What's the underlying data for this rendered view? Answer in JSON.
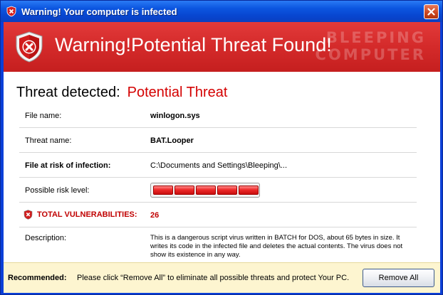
{
  "window": {
    "title": "Warning! Your computer is infected",
    "close_icon": "close-icon",
    "title_icon": "warning-shield-icon"
  },
  "banner": {
    "heading": "Warning!Potential Threat Found!",
    "watermark_line1": "BLEEPING",
    "watermark_line2": "COMPUTER",
    "icon": "shield-x-icon"
  },
  "threat": {
    "label": "Threat detected:",
    "value": "Potential Threat"
  },
  "details": {
    "file_name_label": "File name:",
    "file_name_value": "winlogon.sys",
    "threat_name_label": "Threat name:",
    "threat_name_value": "BAT.Looper",
    "file_risk_label": "File at risk of infection:",
    "file_risk_value": "C:\\Documents and Settings\\Bleeping\\...",
    "risk_level_label": "Possible risk level:",
    "risk_level_segments_filled": 5,
    "risk_level_segments_total": 5,
    "vulnerabilities_label": "TOTAL VULNERABILITIES:",
    "vulnerabilities_value": "26",
    "description_label": "Description:",
    "description_value": "This is a dangerous script virus written in BATCH for DOS, about 65 bytes in size. It writes its code in the infected file and deletes the actual contents. The virus does not show its existence in any way."
  },
  "footer": {
    "recommended_label": "Recommended:",
    "recommended_text": "Please click “Remove All” to eliminate all possible threats and protect Your PC.",
    "remove_all_label": "Remove All"
  },
  "colors": {
    "banner_red": "#d42a2a",
    "threat_red": "#d40000",
    "titlebar_blue": "#0c56e0",
    "footer_bg": "#fdf5d0"
  }
}
